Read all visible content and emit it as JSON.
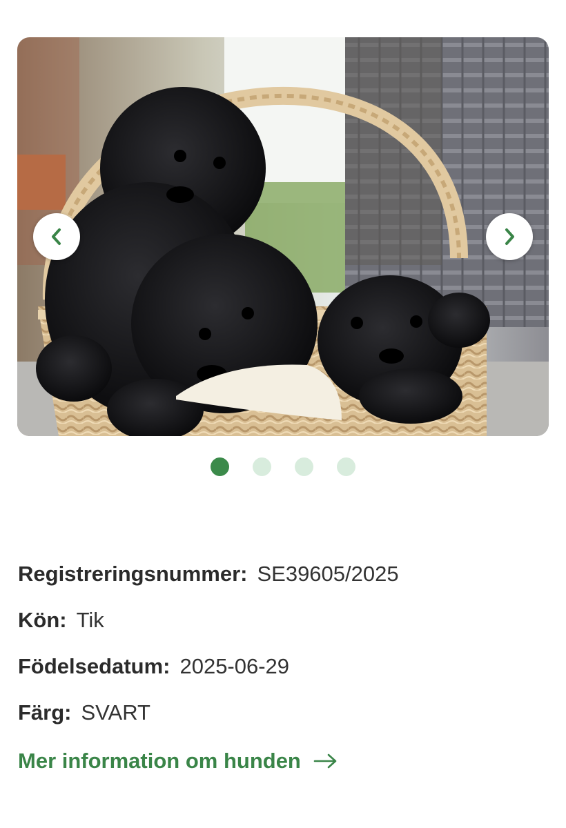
{
  "carousel": {
    "image_alt": "Tre svarta valpar i en korg",
    "slide_count": 4,
    "active_index": 0,
    "prev_icon": "chevron-left-icon",
    "next_icon": "chevron-right-icon"
  },
  "details": {
    "reg_label": "Registreringsnummer:",
    "reg_value": "SE39605/2025",
    "sex_label": "Kön:",
    "sex_value": "Tik",
    "birth_label": "Födelsedatum:",
    "birth_value": "2025-06-29",
    "color_label": "Färg:",
    "color_value": "SVART"
  },
  "link": {
    "label": "Mer information om hunden",
    "icon": "arrow-right-icon"
  },
  "colors": {
    "accent": "#3a8548",
    "dot_active": "#3b8a4a",
    "dot_inactive": "#d8ecdd"
  }
}
